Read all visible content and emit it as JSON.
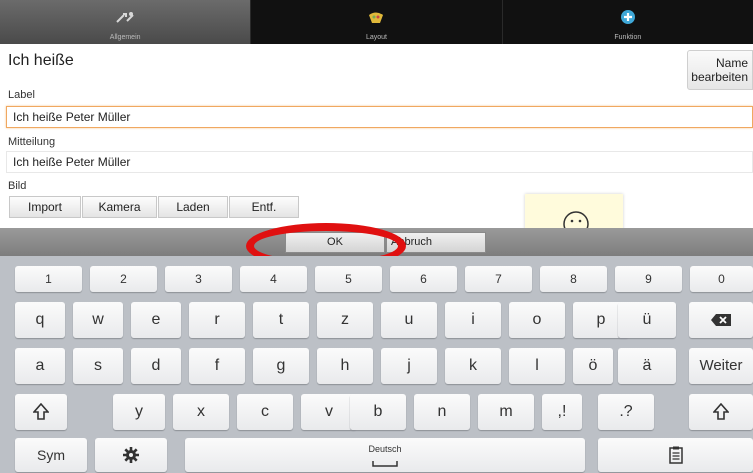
{
  "tabs": [
    {
      "label": "Allgemein",
      "icon": "tools-icon",
      "active": true
    },
    {
      "label": "Layout",
      "icon": "palette-icon",
      "active": false
    },
    {
      "label": "Funktion",
      "icon": "plus-circle-icon",
      "active": false
    }
  ],
  "form": {
    "title": "Ich heiße",
    "name_button_line1": "Name",
    "name_button_line2": "bearbeiten",
    "label_caption": "Label",
    "label_value": "Ich heiße Peter Müller",
    "message_caption": "Mitteilung",
    "message_value": "Ich heiße Peter Müller",
    "image_caption": "Bild",
    "image_buttons": [
      "Import",
      "Kamera",
      "Laden",
      "Entf."
    ]
  },
  "dialog": {
    "ok": "OK",
    "cancel": "Abbruch"
  },
  "keyboard": {
    "row_digits": [
      "1",
      "2",
      "3",
      "4",
      "5",
      "6",
      "7",
      "8",
      "9",
      "0"
    ],
    "row_q": [
      "q",
      "w",
      "e",
      "r",
      "t",
      "z",
      "u",
      "i",
      "o",
      "p",
      "ü"
    ],
    "row_a": [
      "a",
      "s",
      "d",
      "f",
      "g",
      "h",
      "j",
      "k",
      "l",
      "ö",
      "ä"
    ],
    "row_y": [
      "y",
      "x",
      "c",
      "v",
      "b",
      "n",
      "m"
    ],
    "comma_key": ",!",
    "period_key": ".?",
    "enter_label": "Weiter",
    "sym_label": "Sym",
    "space_label": "Deutsch"
  },
  "colors": {
    "highlight_ring": "#e01010",
    "focus_border": "#f0a860"
  }
}
